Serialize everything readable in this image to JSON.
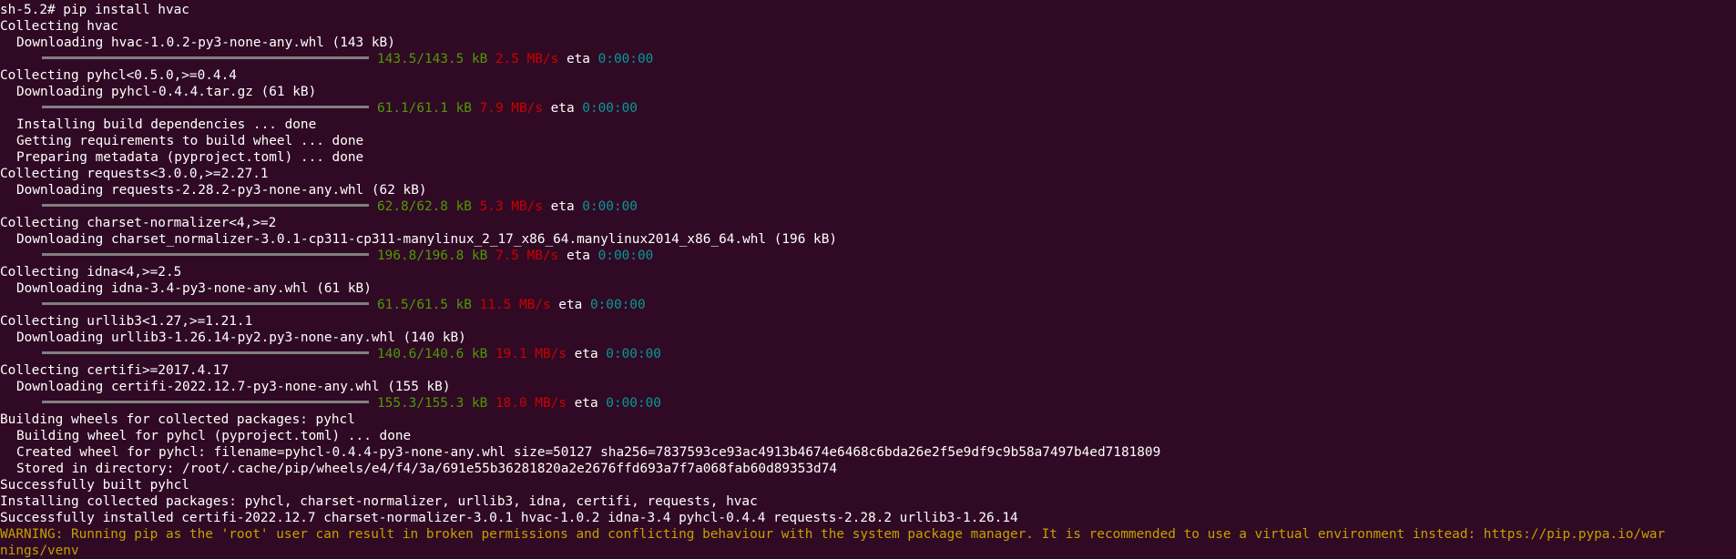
{
  "terminal": {
    "prompt": "sh-5.2# pip install hvac",
    "lines": {
      "l1": "Collecting hvac",
      "l2": "Downloading hvac-1.0.2-py3-none-any.whl (143 kB)",
      "l4": "Collecting pyhcl<0.5.0,>=0.4.4",
      "l5": "Downloading pyhcl-0.4.4.tar.gz (61 kB)",
      "l7": "Installing build dependencies ... done",
      "l8": "Getting requirements to build wheel ... done",
      "l9": "Preparing metadata (pyproject.toml) ... done",
      "l10": "Collecting requests<3.0.0,>=2.27.1",
      "l11": "Downloading requests-2.28.2-py3-none-any.whl (62 kB)",
      "l13": "Collecting charset-normalizer<4,>=2",
      "l14": "Downloading charset_normalizer-3.0.1-cp311-cp311-manylinux_2_17_x86_64.manylinux2014_x86_64.whl (196 kB)",
      "l16": "Collecting idna<4,>=2.5",
      "l17": "Downloading idna-3.4-py3-none-any.whl (61 kB)",
      "l19": "Collecting urllib3<1.27,>=1.21.1",
      "l20": "Downloading urllib3-1.26.14-py2.py3-none-any.whl (140 kB)",
      "l22": "Collecting certifi>=2017.4.17",
      "l23": "Downloading certifi-2022.12.7-py3-none-any.whl (155 kB)",
      "l25": "Building wheels for collected packages: pyhcl",
      "l26": "Building wheel for pyhcl (pyproject.toml) ... done",
      "l27": "Created wheel for pyhcl: filename=pyhcl-0.4.4-py3-none-any.whl size=50127 sha256=7837593ce93ac4913b4674e6468c6bda26e2f5e9df9c9b58a7497b4ed7181809",
      "l28": "Stored in directory: /root/.cache/pip/wheels/e4/f4/3a/691e55b36281820a2e2676ffd693a7f7a068fab60d89353d74",
      "l29": "Successfully built pyhcl",
      "l30": "Installing collected packages: pyhcl, charset-normalizer, urllib3, idna, certifi, requests, hvac",
      "l31": "Successfully installed certifi-2022.12.7 charset-normalizer-3.0.1 hvac-1.0.2 idna-3.4 pyhcl-0.4.4 requests-2.28.2 urllib3-1.26.14",
      "warning_1": "WARNING: Running pip as the 'root' user can result in broken permissions and conflicting behaviour with the system package manager. It is recommended to use a virtual environment instead: https://pip.pypa.io/war",
      "warning_2": "nings/venv"
    },
    "progress": [
      {
        "size": "143.5/143.5 kB",
        "speed": "2.5 MB/s",
        "eta_label": "eta",
        "eta": "0:00:00"
      },
      {
        "size": "61.1/61.1 kB",
        "speed": "7.9 MB/s",
        "eta_label": "eta",
        "eta": "0:00:00"
      },
      {
        "size": "62.8/62.8 kB",
        "speed": "5.3 MB/s",
        "eta_label": "eta",
        "eta": "0:00:00"
      },
      {
        "size": "196.8/196.8 kB",
        "speed": "7.5 MB/s",
        "eta_label": "eta",
        "eta": "0:00:00"
      },
      {
        "size": "61.5/61.5 kB",
        "speed": "11.5 MB/s",
        "eta_label": "eta",
        "eta": "0:00:00"
      },
      {
        "size": "140.6/140.6 kB",
        "speed": "19.1 MB/s",
        "eta_label": "eta",
        "eta": "0:00:00"
      },
      {
        "size": "155.3/155.3 kB",
        "speed": "18.0 MB/s",
        "eta_label": "eta",
        "eta": "0:00:00"
      }
    ],
    "progress_fraction": 1.0,
    "colors": {
      "background": "#300a24",
      "text": "#ffffff",
      "size": "#4e9a06",
      "speed": "#cc0000",
      "eta": "#06989a",
      "warning": "#c4a000",
      "bar": "#808080"
    }
  }
}
